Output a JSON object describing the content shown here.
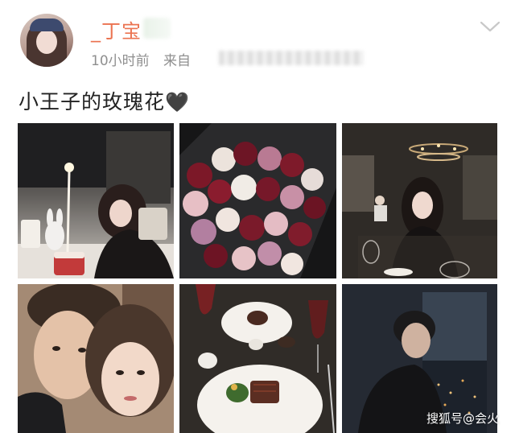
{
  "post": {
    "username": "_丁宝",
    "time": "10小时前",
    "source_label": "来自",
    "text": "小王子的玫瑰花",
    "heart_glyph": "🖤"
  },
  "watermark": "搜狐号@会火",
  "icons": {
    "chevron": "chevron-down-icon",
    "heart": "black-heart-icon"
  },
  "photos": [
    {
      "name": "photo-birthday-cake"
    },
    {
      "name": "photo-rose-bouquet"
    },
    {
      "name": "photo-restaurant-portrait"
    },
    {
      "name": "photo-couple-selfie"
    },
    {
      "name": "photo-steak-dinner"
    },
    {
      "name": "photo-man-window"
    }
  ],
  "colors": {
    "username": "#eb7350",
    "meta": "#8f8f8f",
    "text": "#222222"
  }
}
